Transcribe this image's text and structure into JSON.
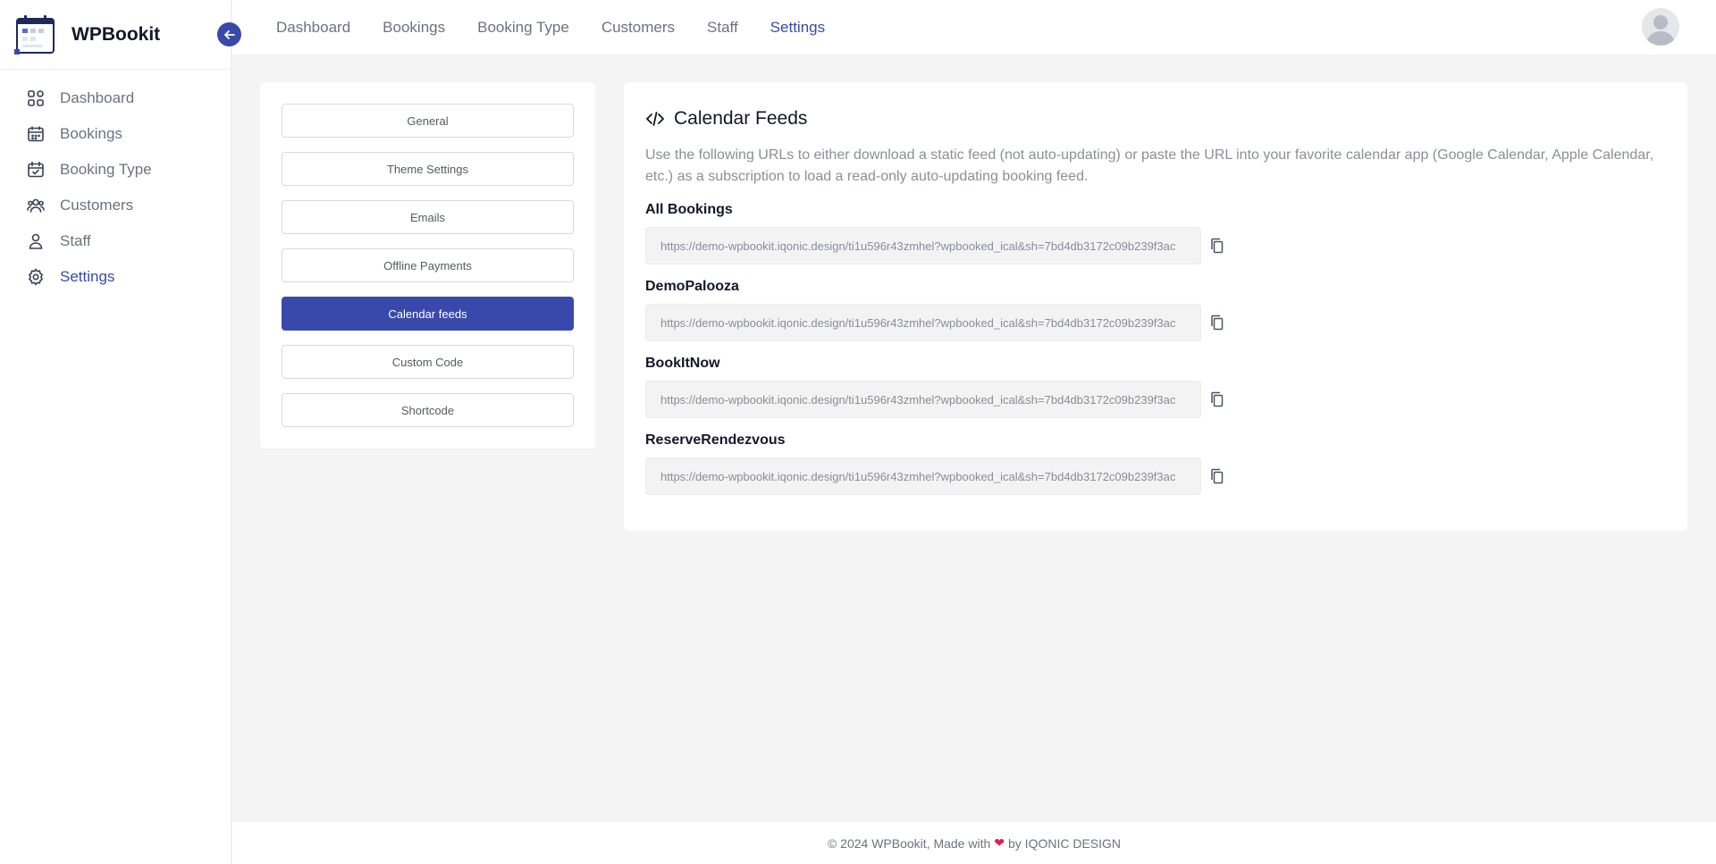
{
  "brand": {
    "name": "WPBookit"
  },
  "sidebar": {
    "items": [
      {
        "label": "Dashboard",
        "icon": "dashboard-icon",
        "active": false
      },
      {
        "label": "Bookings",
        "icon": "calendar-icon",
        "active": false
      },
      {
        "label": "Booking Type",
        "icon": "calendar-check-icon",
        "active": false
      },
      {
        "label": "Customers",
        "icon": "users-icon",
        "active": false
      },
      {
        "label": "Staff",
        "icon": "user-icon",
        "active": false
      },
      {
        "label": "Settings",
        "icon": "gear-icon",
        "active": true
      }
    ]
  },
  "topnav": {
    "items": [
      {
        "label": "Dashboard",
        "active": false
      },
      {
        "label": "Bookings",
        "active": false
      },
      {
        "label": "Booking Type",
        "active": false
      },
      {
        "label": "Customers",
        "active": false
      },
      {
        "label": "Staff",
        "active": false
      },
      {
        "label": "Settings",
        "active": true
      }
    ]
  },
  "settings_menu": {
    "items": [
      {
        "label": "General",
        "active": false
      },
      {
        "label": "Theme Settings",
        "active": false
      },
      {
        "label": "Emails",
        "active": false
      },
      {
        "label": "Offline Payments",
        "active": false
      },
      {
        "label": "Calendar feeds",
        "active": true
      },
      {
        "label": "Custom Code",
        "active": false
      },
      {
        "label": "Shortcode",
        "active": false
      }
    ]
  },
  "main": {
    "title": "Calendar Feeds",
    "description": "Use the following URLs to either download a static feed (not auto-updating) or paste the URL into your favorite calendar app (Google Calendar, Apple Calendar, etc.) as a subscription to load a read-only auto-updating booking feed.",
    "feeds": [
      {
        "label": "All Bookings",
        "url": "https://demo-wpbookit.iqonic.design/ti1u596r43zmhel?wpbooked_ical&sh=7bd4db3172c09b239f3ac"
      },
      {
        "label": "DemoPalooza",
        "url": "https://demo-wpbookit.iqonic.design/ti1u596r43zmhel?wpbooked_ical&sh=7bd4db3172c09b239f3ac"
      },
      {
        "label": "BookItNow",
        "url": "https://demo-wpbookit.iqonic.design/ti1u596r43zmhel?wpbooked_ical&sh=7bd4db3172c09b239f3ac"
      },
      {
        "label": "ReserveRendezvous",
        "url": "https://demo-wpbookit.iqonic.design/ti1u596r43zmhel?wpbooked_ical&sh=7bd4db3172c09b239f3ac"
      }
    ]
  },
  "footer": {
    "prefix": "© 2024 WPBookit, Made with",
    "suffix": "by IQONIC DESIGN"
  },
  "colors": {
    "accent": "#3949ab",
    "heart": "#e11d48",
    "background": "#f4f4f5"
  }
}
